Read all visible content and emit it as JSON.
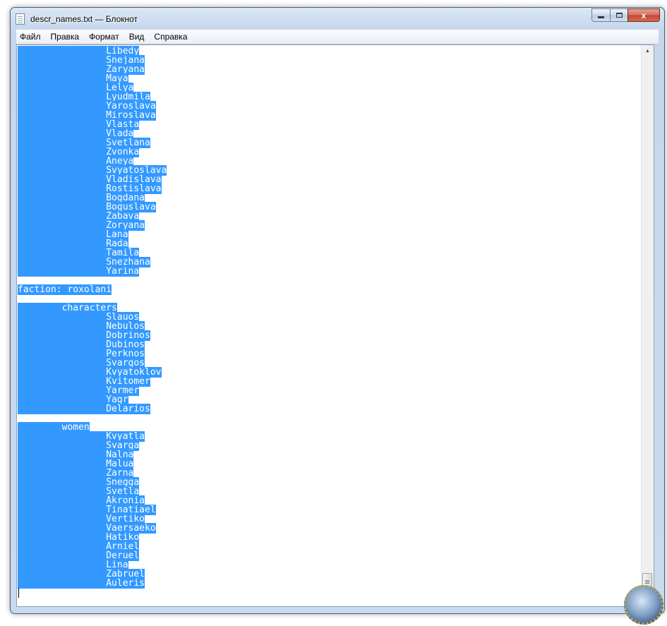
{
  "window": {
    "title": "descr_names.txt — Блокнот",
    "close_glyph": "x"
  },
  "menu": [
    "Файл",
    "Правка",
    "Формат",
    "Вид",
    "Справка"
  ],
  "editor": {
    "selection_color": "#3399ff",
    "lines": [
      "                Libedy",
      "                Snejana",
      "                Zaryana",
      "                Maya",
      "                Lelya",
      "                Lyudmila",
      "                Yaroslava",
      "                Miroslava",
      "                Vlasta",
      "                Vlada",
      "                Svetlana",
      "                Zvonka",
      "                Aneya",
      "                Svyatoslava",
      "                Vladislava",
      "                Rostislava",
      "                Bogdana",
      "                Boguslava",
      "                Zabava",
      "                Zoryana",
      "                Lana",
      "                Rada",
      "                Tamila",
      "                Snezhana",
      "                Yarina",
      "",
      "faction: roxolani",
      "",
      "        characters",
      "                Slauos",
      "                Nebulos",
      "                Dobrinos",
      "                Dubinos",
      "                Perknos",
      "                Svargos",
      "                Kvyatoklov",
      "                Kvitomer",
      "                Yarmer",
      "                Yagr",
      "                Delarios",
      "",
      "        women",
      "                Kvyatla",
      "                Svarga",
      "                Nalna",
      "                Malua",
      "                Zarna",
      "                Snegga",
      "                Svetla",
      "                Akronia",
      "                Tinatiael",
      "                Vertiko",
      "                Vaersaeko",
      "                Hatiko",
      "                Arniel",
      "                Deruel",
      "                Lina",
      "                Zabruel",
      "                Auleris"
    ]
  },
  "icons": {
    "app": "notepad-icon",
    "minimize": "minimize-icon",
    "maximize": "maximize-icon",
    "close": "close-icon",
    "scroll_up": "chevron-up-icon",
    "scroll_down": "chevron-down-icon",
    "watermark": "emblem-watermark"
  }
}
